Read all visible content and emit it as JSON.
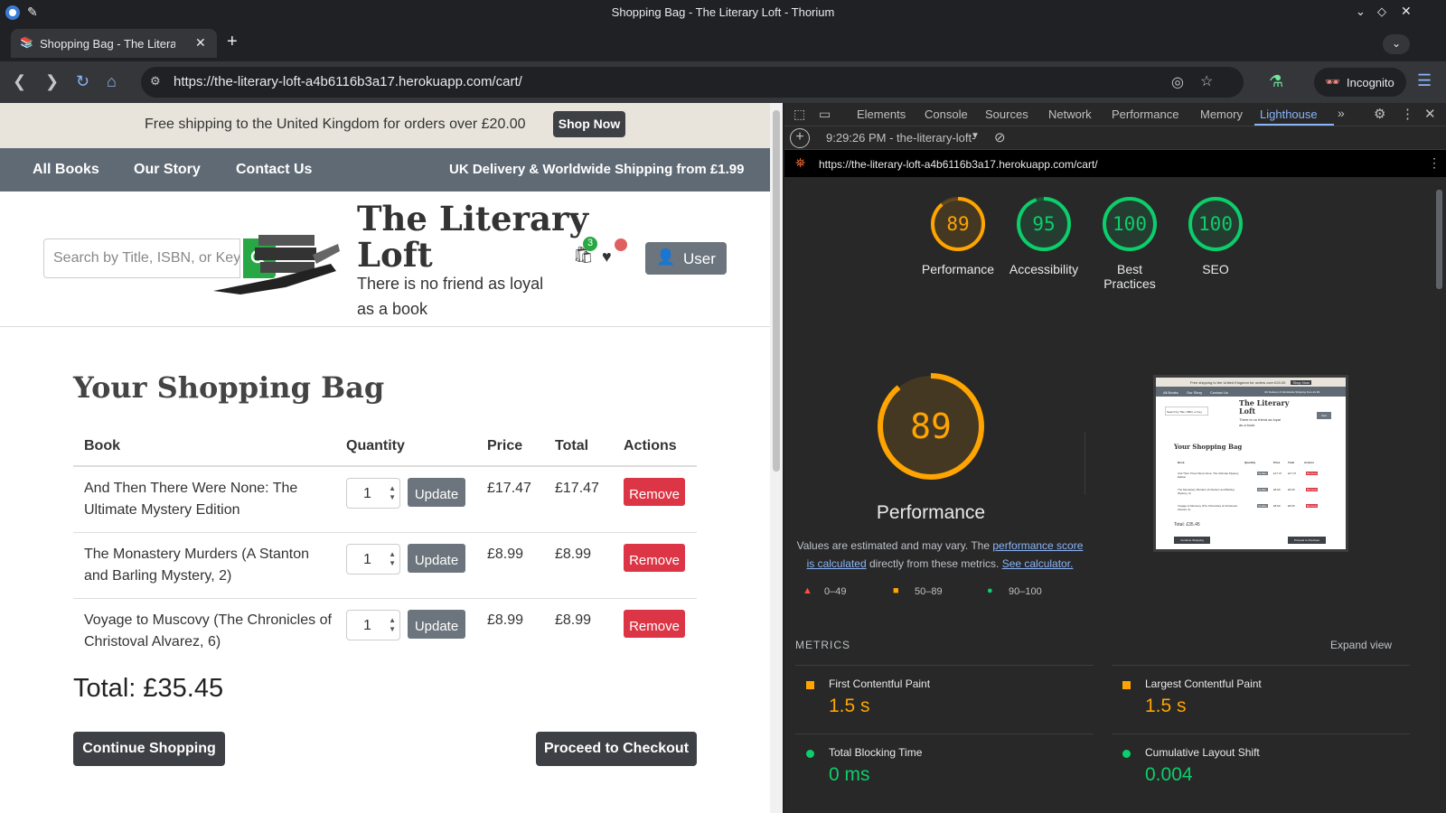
{
  "window": {
    "title": "Shopping Bag - The Literary Loft - Thorium"
  },
  "tab": {
    "title": "Shopping Bag - The Literary Loft",
    "new_tab": "+"
  },
  "omnibox": {
    "url": "https://the-literary-loft-a4b6116b3a17.herokuapp.com/cart/"
  },
  "incognito": {
    "label": "Incognito"
  },
  "site": {
    "announce": {
      "text": "Free shipping to the United Kingdom for orders over £20.00",
      "shop_now": "Shop Now"
    },
    "nav": {
      "all_books": "All Books",
      "our_story": "Our Story",
      "contact": "Contact Us",
      "delivery": "UK Delivery & Worldwide Shipping from £1.99"
    },
    "search": {
      "placeholder": "Search by Title, ISBN, or Key"
    },
    "brand": {
      "line1": "The Literary",
      "line2": "Loft",
      "tagline": "There is no friend as loyal as a book"
    },
    "bag_count": "3",
    "user_button": "User",
    "cart": {
      "title": "Your Shopping Bag",
      "headers": {
        "book": "Book",
        "quantity": "Quantity",
        "price": "Price",
        "total": "Total",
        "actions": "Actions"
      },
      "rows": [
        {
          "book": "And Then There Were None: The Ultimate Mystery Edition",
          "qty": "1",
          "update": "Update",
          "price": "£17.47",
          "total": "£17.47",
          "remove": "Remove"
        },
        {
          "book": "The Monastery Murders (A Stanton and Barling Mystery, 2)",
          "qty": "1",
          "update": "Update",
          "price": "£8.99",
          "total": "£8.99",
          "remove": "Remove"
        },
        {
          "book": "Voyage to Muscovy (The Chronicles of Christoval Alvarez, 6)",
          "qty": "1",
          "update": "Update",
          "price": "£8.99",
          "total": "£8.99",
          "remove": "Remove"
        }
      ],
      "total": "Total: £35.45",
      "continue": "Continue Shopping",
      "checkout": "Proceed to Checkout"
    }
  },
  "devtools": {
    "tabs": [
      "Elements",
      "Console",
      "Sources",
      "Network",
      "Performance",
      "Memory",
      "Lighthouse"
    ],
    "active_tab": "Lighthouse",
    "report_select": "9:29:26 PM - the-literary-loft-",
    "report_url": "https://the-literary-loft-a4b6116b3a17.herokuapp.com/cart/",
    "scores": [
      {
        "value": "89",
        "label": "Performance",
        "color": "#ffa400"
      },
      {
        "value": "95",
        "label": "Accessibility",
        "color": "#0cce6b"
      },
      {
        "value": "100",
        "label": "Best Practices",
        "color": "#0cce6b"
      },
      {
        "value": "100",
        "label": "SEO",
        "color": "#0cce6b"
      }
    ],
    "big_score": {
      "value": "89",
      "label": "Performance"
    },
    "note": {
      "prefix": "Values are estimated and may vary. The ",
      "link1": "performance score is calculated",
      "middle": " directly from these metrics. ",
      "link2": "See calculator."
    },
    "legend": [
      "0–49",
      "50–89",
      "90–100"
    ],
    "metrics_title": "METRICS",
    "expand": "Expand view",
    "metrics": [
      {
        "name": "First Contentful Paint",
        "value": "1.5 s",
        "color": "#ffa400"
      },
      {
        "name": "Largest Contentful Paint",
        "value": "1.5 s",
        "color": "#ffa400"
      },
      {
        "name": "Total Blocking Time",
        "value": "0 ms",
        "color": "#0cce6b"
      },
      {
        "name": "Cumulative Layout Shift",
        "value": "0.004",
        "color": "#0cce6b"
      }
    ],
    "thumb": {
      "announce": "Free shipping to the United Kingdom for orders over £20.00",
      "shop": "Shop Now",
      "nav_all": "All Books",
      "nav_story": "Our Story",
      "nav_contact": "Contact Us",
      "nav_delivery": "UK Delivery & Worldwide Shipping from £1.99",
      "brand1": "The Literary",
      "brand2": "Loft",
      "tagline": "There is no friend as loyal as a book",
      "search": "Search by Title, ISBN, or Key",
      "user": "User",
      "title": "Your Shopping Bag",
      "h_book": "Book",
      "h_qty": "Quantity",
      "h_price": "Price",
      "h_total": "Total",
      "h_actions": "Actions",
      "row1": "And Then There Were None: The Ultimate Mystery Edition",
      "row2": "The Monastery Murders (A Stanton and Barling Mystery, 2)",
      "row3": "Voyage to Muscovy (The Chronicles of Christoval Alvarez, 6)",
      "update": "Update",
      "remove": "Remove",
      "p1": "£17.47",
      "p2": "£8.99",
      "p3": "£8.99",
      "total": "Total: £35.45",
      "continue": "Continue Shopping",
      "checkout": "Proceed to Checkout"
    }
  }
}
